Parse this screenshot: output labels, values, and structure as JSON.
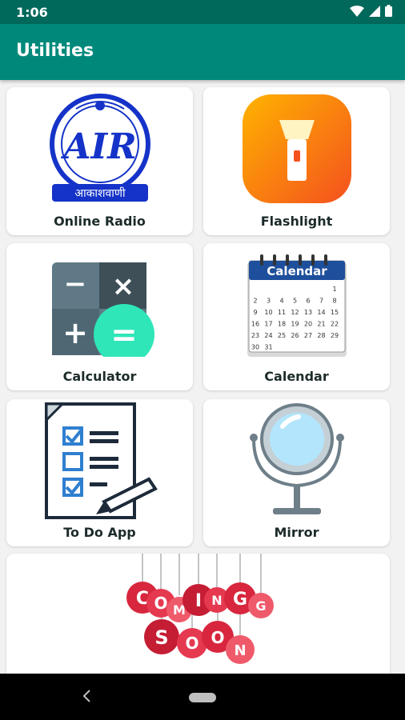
{
  "status_bar": {
    "time": "1:06",
    "icons": [
      "wifi-icon",
      "signal-icon",
      "battery-icon"
    ]
  },
  "app_bar": {
    "title": "Utilities"
  },
  "grid": {
    "items": [
      {
        "label": "Online Radio",
        "icon": "air-logo-icon"
      },
      {
        "label": "Flashlight",
        "icon": "flashlight-icon"
      },
      {
        "label": "Calculator",
        "icon": "calculator-icon"
      },
      {
        "label": "Calendar",
        "icon": "calendar-icon"
      },
      {
        "label": "To Do App",
        "icon": "todo-checklist-icon"
      },
      {
        "label": "Mirror",
        "icon": "mirror-icon"
      }
    ]
  },
  "coming_soon": {
    "icon": "coming-soon-banner",
    "word1": "COMING",
    "word2": "SOON"
  },
  "logo_text": {
    "air": "AIR",
    "akashvani": "आकाशवाणी"
  },
  "calendar_art": {
    "header": "Calendar",
    "numbers": [
      "1",
      "2",
      "3",
      "4",
      "5",
      "6",
      "7",
      "8",
      "9",
      "10",
      "11",
      "12",
      "13",
      "14",
      "15",
      "16",
      "17",
      "18",
      "19",
      "20",
      "21",
      "22",
      "23",
      "24",
      "25",
      "26",
      "27",
      "28",
      "29",
      "30",
      "31"
    ]
  },
  "calculator_art": {
    "keys": [
      "−",
      "×",
      "+",
      "="
    ]
  },
  "nav_bar": {
    "buttons": [
      "back-icon",
      "home-icon"
    ]
  },
  "colors": {
    "status_bar": "#00695c",
    "app_bar": "#00897b",
    "background": "#f2f2f2",
    "card": "#ffffff"
  }
}
